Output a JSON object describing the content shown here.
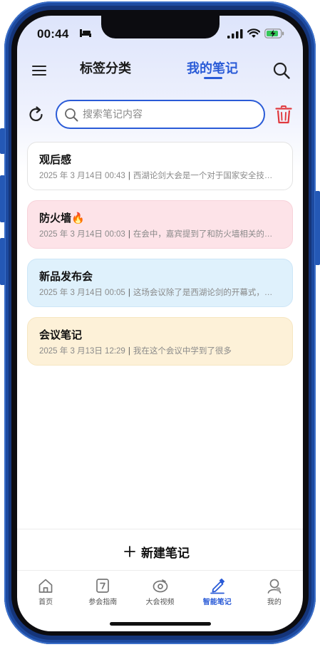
{
  "status_bar": {
    "time": "00:44"
  },
  "header": {
    "tab_tags": "标签分类",
    "tab_notes": "我的笔记",
    "active_tab": "tab_notes",
    "accent": "#2a5bd7"
  },
  "search": {
    "placeholder": "搜索笔记内容",
    "value": ""
  },
  "notes": [
    {
      "title": "观后感",
      "date": "2025 年 3 月14日 00:43",
      "preview": "西湖论剑大会是一个对于国家安全技…",
      "bg": "#ffffff",
      "border": "#e3e3e3"
    },
    {
      "title": "防火墙🔥",
      "date": "2025 年 3 月14日 00:03",
      "preview": "在会中，嘉宾提到了和防火墙相关的…",
      "bg": "#fde3e8",
      "border": "#f7d3da"
    },
    {
      "title": "新品发布会",
      "date": "2025 年 3 月14日 00:05",
      "preview": "这场会议除了是西湖论剑的开幕式，…",
      "bg": "#dff1fc",
      "border": "#cde6f7"
    },
    {
      "title": "会议笔记",
      "date": "2025 年 3 月13日 12:29",
      "preview": "我在这个会议中学到了很多",
      "bg": "#fdf1d8",
      "border": "#f6e6c2"
    }
  ],
  "new_note": {
    "label": "新建笔记"
  },
  "tabbar": [
    {
      "label": "首页",
      "icon": "home-icon",
      "active": false
    },
    {
      "label": "参会指南",
      "icon": "guide-icon",
      "active": false
    },
    {
      "label": "大会视频",
      "icon": "video-icon",
      "active": false
    },
    {
      "label": "智能笔记",
      "icon": "pen-icon",
      "active": true
    },
    {
      "label": "我的",
      "icon": "profile-icon",
      "active": false
    }
  ],
  "colors": {
    "danger": "#e0393e",
    "frame": "#15357a"
  }
}
